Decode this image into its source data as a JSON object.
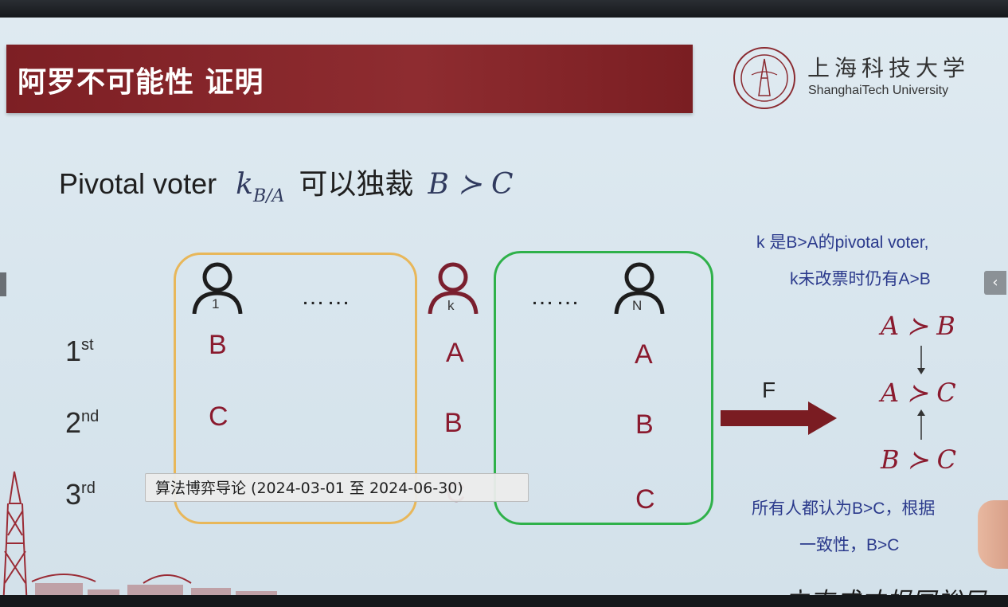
{
  "slide": {
    "title": "阿罗不可能性 证明",
    "university_cn": "上海科技大学",
    "university_en": "ShanghaiTech University",
    "subtitle_prefix": "Pivotal voter",
    "subtitle_k": "k",
    "subtitle_sub": "B/A",
    "subtitle_mid": "可以独裁",
    "subtitle_rel": "B ≻ C",
    "slogan": "立志成才报国裕民"
  },
  "voters": {
    "v1": "1",
    "vk": "k",
    "vn": "N",
    "dots_left": "……",
    "dots_right": "……"
  },
  "ranks": [
    {
      "base": "1",
      "sup": "st"
    },
    {
      "base": "2",
      "sup": "nd"
    },
    {
      "base": "3",
      "sup": "rd"
    }
  ],
  "preferences": {
    "group1": [
      "B",
      "C"
    ],
    "k": [
      "A",
      "B",
      "C"
    ],
    "groupN": [
      "A",
      "B",
      "C"
    ]
  },
  "notes": {
    "line1": "k 是B>A的pivotal voter,",
    "line2": "k未改票时仍有A>B",
    "conclusion1": "所有人都认为B>C，根据",
    "conclusion2": "一致性，B>C"
  },
  "relations": {
    "r1": "A ≻ B",
    "r2": "A ≻ C",
    "r3": "B ≻ C"
  },
  "arrow_label": "F",
  "caption": "算法博弈导论 (2024-03-01 至 2024-06-30)",
  "nav_right": "‹",
  "colors": {
    "title_bar": "#7d1f24",
    "left_box": "#e8b75a",
    "right_box": "#2fb14a",
    "preference_text": "#8a1a2e",
    "note_text": "#2b3a8c",
    "arrow": "#7a1c22"
  }
}
